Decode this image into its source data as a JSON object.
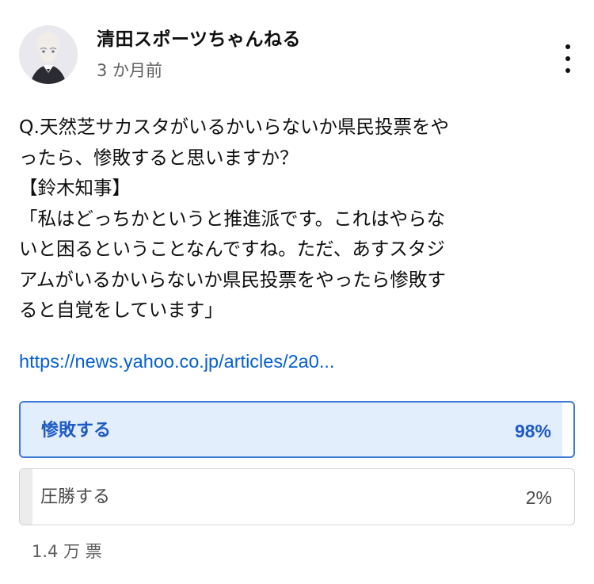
{
  "post": {
    "channel_name": "清田スポーツちゃんねる",
    "timestamp": "3 か月前",
    "menu_icon": "more-vertical-icon",
    "avatar_icon": "channel-avatar",
    "body_lines": [
      "Q.天然芝サカスタがいるかいらないか県民投票をや",
      "ったら、惨敗すると思いますか？",
      "【鈴木知事】",
      "「私はどっちかというと推進派です。これはやらな",
      "いと困るということなんですね。ただ、あすスタジ",
      "アムがいるかいらないか県民投票をやったら惨敗す",
      "ると自覚をしています」"
    ],
    "link_text": "https://news.yahoo.co.jp/articles/2a0..."
  },
  "poll": {
    "options": [
      {
        "label": "惨敗する",
        "percent_text": "98%",
        "fraction": 0.98,
        "selected": true
      },
      {
        "label": "圧勝する",
        "percent_text": "2%",
        "fraction": 0.02,
        "selected": false
      }
    ],
    "vote_count": "1.4 万 票"
  },
  "colors": {
    "link": "#065fd4",
    "selected_border": "#3e78d6",
    "selected_fill": "#e3eefc",
    "selected_text": "#1f5bc4",
    "unselected_fill": "#ececec"
  }
}
